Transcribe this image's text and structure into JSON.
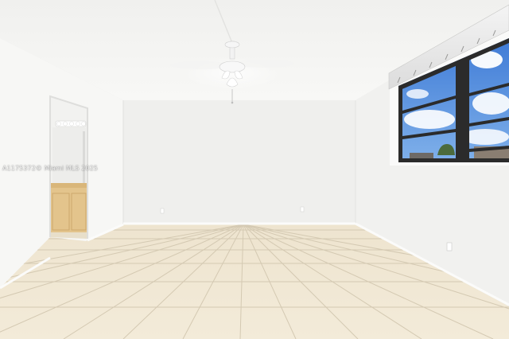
{
  "photo": {
    "subject": "empty-room-interior",
    "watermark": "A1175372© Miami MLS 2025"
  },
  "colors": {
    "ceiling": "#f4f4f2",
    "wall_back": "#efefed",
    "wall_left": "#f7f7f5",
    "wall_right": "#f1f1ef",
    "floor_tile": "#efe6d2",
    "grout": "#d4c9b2",
    "window_frame": "#2b2b2b",
    "sky": "#4a84d8",
    "cabinet": "#e3c48c"
  },
  "icons": [
    "ceiling-fan-icon"
  ]
}
